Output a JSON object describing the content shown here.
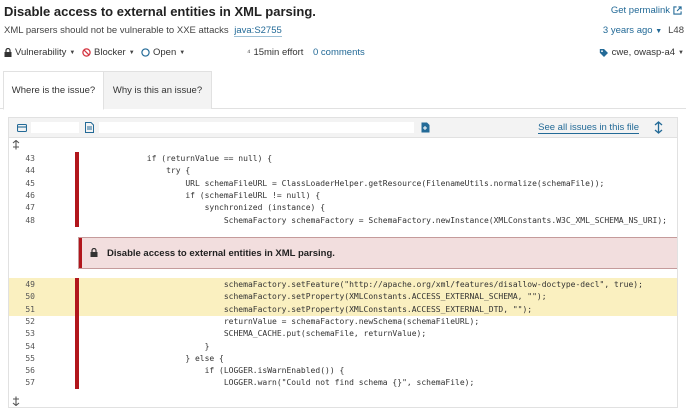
{
  "header": {
    "title": "Disable access to external entities in XML parsing.",
    "subtitle": "XML parsers should not be vulnerable to XXE attacks",
    "rule_key": "java:S2755",
    "permalink": "Get permalink",
    "age": "3 years ago",
    "line": "L48"
  },
  "meta": {
    "type": "Vulnerability",
    "severity": "Blocker",
    "status": "Open",
    "effort": "15min effort",
    "comments": "0 comments",
    "tags": "cwe, owasp-a4"
  },
  "tabs": [
    "Where is the issue?",
    "Why is this an issue?"
  ],
  "viewer": {
    "see_all": "See all issues in this file"
  },
  "issue_message": "Disable access to external entities in XML parsing.",
  "code_top": [
    {
      "n": "43",
      "text": "            if (returnValue == null) {"
    },
    {
      "n": "44",
      "text": "                try {"
    },
    {
      "n": "45",
      "text": "                    URL schemaFileURL = ClassLoaderHelper.getResource(FilenameUtils.normalize(schemaFile));"
    },
    {
      "n": "46",
      "text": "                    if (schemaFileURL != null) {"
    },
    {
      "n": "47",
      "text": "                        synchronized (instance) {"
    },
    {
      "n": "48",
      "text": "                            SchemaFactory schemaFactory = SchemaFactory.newInstance(XMLConstants.W3C_XML_SCHEMA_NS_URI);"
    }
  ],
  "code_bottom": [
    {
      "n": "49",
      "text": "                            schemaFactory.setFeature(\"http://apache.org/xml/features/disallow-doctype-decl\", true);"
    },
    {
      "n": "50",
      "text": "                            schemaFactory.setProperty(XMLConstants.ACCESS_EXTERNAL_SCHEMA, \"\");"
    },
    {
      "n": "51",
      "text": "                            schemaFactory.setProperty(XMLConstants.ACCESS_EXTERNAL_DTD, \"\");"
    },
    {
      "n": "52",
      "text": "                            returnValue = schemaFactory.newSchema(schemaFileURL);"
    },
    {
      "n": "53",
      "text": "                            SCHEMA_CACHE.put(schemaFile, returnValue);"
    },
    {
      "n": "54",
      "text": "                        }"
    },
    {
      "n": "55",
      "text": "                    } else {"
    },
    {
      "n": "56",
      "text": "                        if (LOGGER.isWarnEnabled()) {"
    },
    {
      "n": "57",
      "text": "                            LOGGER.warn(\"Could not find schema {}\", schemaFile);"
    }
  ],
  "colors": {
    "accent": "#236a97",
    "issue_red": "#b1161c",
    "issue_bg": "#f2dede",
    "highlight": "#faf0c0"
  }
}
